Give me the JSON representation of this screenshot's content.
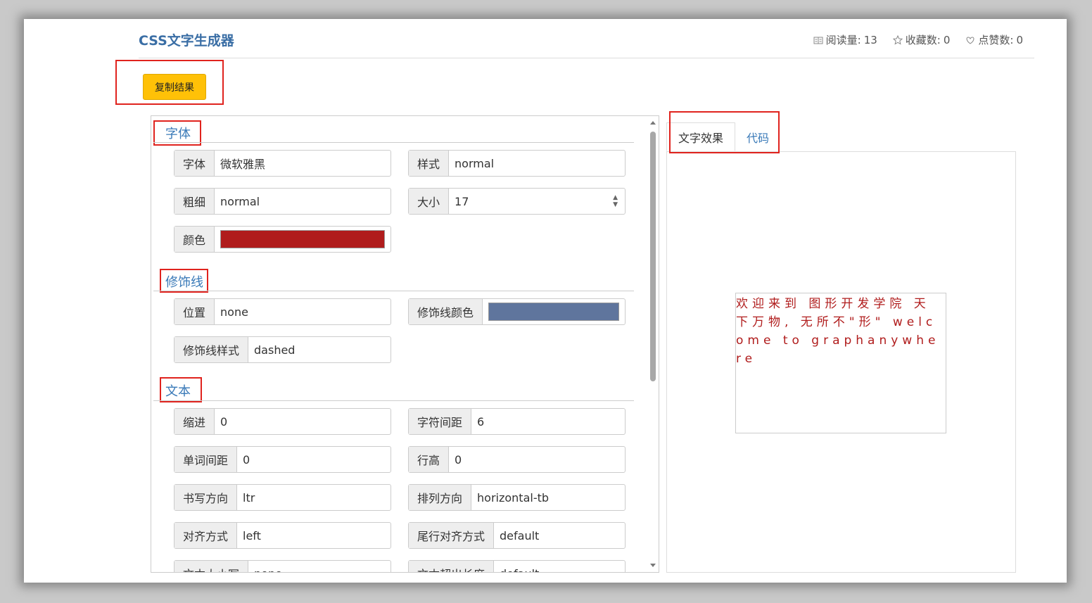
{
  "header": {
    "title": "CSS文字生成器",
    "stats": {
      "read_label": "阅读量:",
      "read_value": "13",
      "favorites_label": "收藏数:",
      "favorites_value": "0",
      "likes_label": "点赞数:",
      "likes_value": "0"
    }
  },
  "toolbar": {
    "copy_label": "复制结果"
  },
  "sections": {
    "font": {
      "title": "字体",
      "family_label": "字体",
      "family_value": "微软雅黑",
      "style_label": "样式",
      "style_value": "normal",
      "weight_label": "粗细",
      "weight_value": "normal",
      "size_label": "大小",
      "size_value": "17",
      "color_label": "颜色",
      "color_value": "#b01c1c"
    },
    "decoration": {
      "title": "修饰线",
      "position_label": "位置",
      "position_value": "none",
      "color_label": "修饰线颜色",
      "color_value": "#5f759d",
      "style_label": "修饰线样式",
      "style_value": "dashed"
    },
    "text": {
      "title": "文本",
      "indent_label": "缩进",
      "indent_value": "0",
      "letter_spacing_label": "字符间距",
      "letter_spacing_value": "6",
      "word_spacing_label": "单词间距",
      "word_spacing_value": "0",
      "line_height_label": "行高",
      "line_height_value": "0",
      "direction_label": "书写方向",
      "direction_value": "ltr",
      "writing_mode_label": "排列方向",
      "writing_mode_value": "horizontal-tb",
      "align_label": "对齐方式",
      "align_value": "left",
      "align_last_label": "尾行对齐方式",
      "align_last_value": "default",
      "transform_label": "文本大小写",
      "transform_value": "none",
      "overflow_label": "文本超出长度",
      "overflow_value": "default"
    }
  },
  "tabs": {
    "effect": "文字效果",
    "code": "代码"
  },
  "preview": {
    "text": "欢迎来到 图形开发学院 天下万物, 无所不\"形\" welcome to graphanywhere"
  },
  "colors": {
    "accent": "#3a7ab8",
    "highlight": "#e0231e",
    "button": "#ffc107"
  }
}
